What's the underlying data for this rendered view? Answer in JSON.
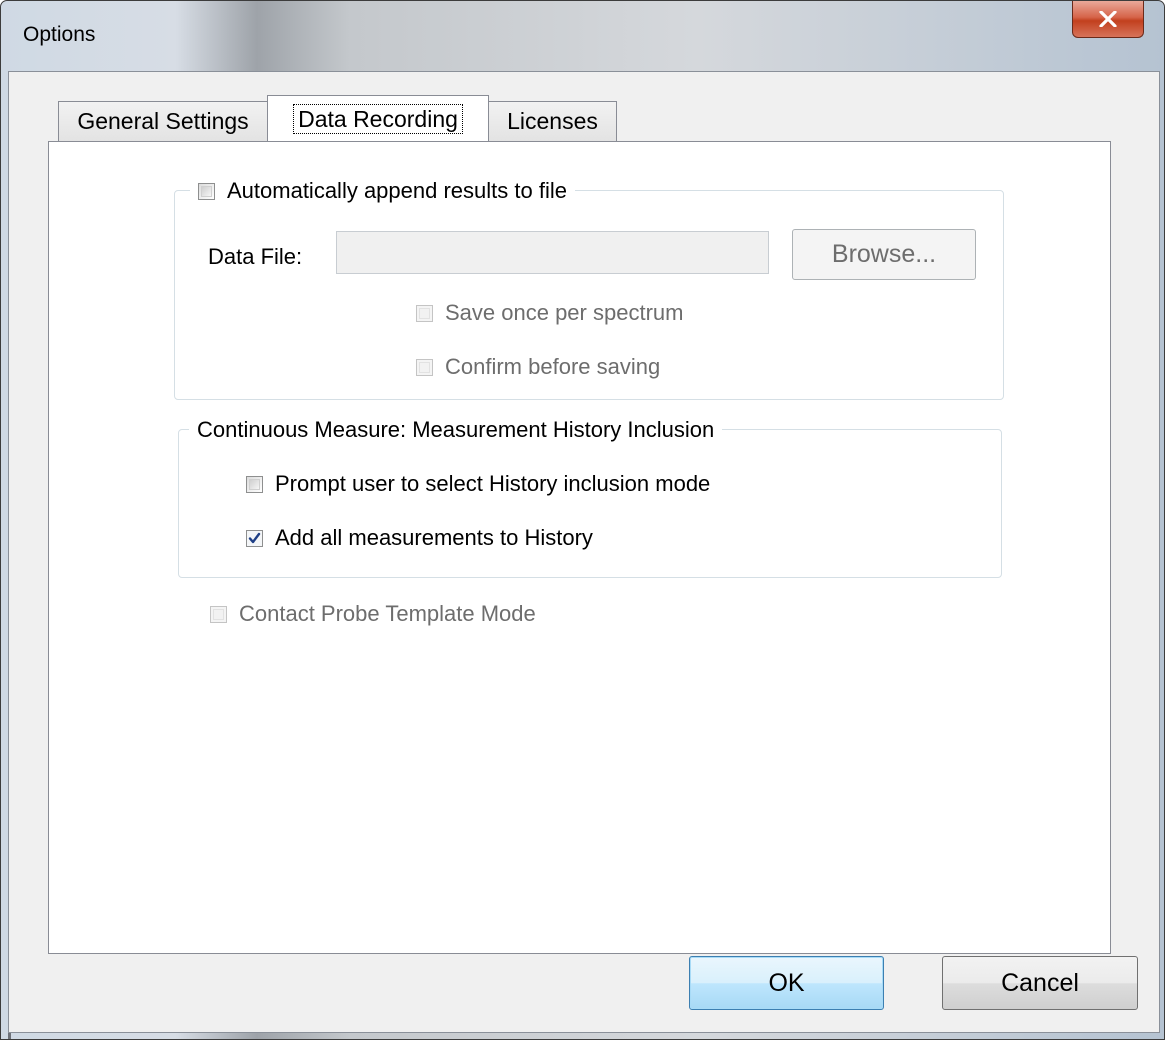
{
  "window": {
    "title": "Options"
  },
  "tabs": [
    {
      "label": "General Settings",
      "active": false
    },
    {
      "label": "Data Recording",
      "active": true
    },
    {
      "label": "Licenses",
      "active": false
    }
  ],
  "append_group": {
    "checkbox_label": "Automatically append results to file",
    "checked": false,
    "data_file_label": "Data File:",
    "data_file_value": "",
    "browse_label": "Browse...",
    "save_once_label": "Save once per spectrum",
    "confirm_label": "Confirm before saving"
  },
  "continuous_group": {
    "title": "Continuous Measure: Measurement History Inclusion",
    "prompt_label": "Prompt user to select History inclusion mode",
    "prompt_checked": false,
    "add_all_label": "Add all measurements to History",
    "add_all_checked": true
  },
  "contact_probe": {
    "label": "Contact Probe Template Mode",
    "checked": false,
    "enabled": false
  },
  "buttons": {
    "ok": "OK",
    "cancel": "Cancel"
  },
  "colors": {
    "close_red": "#c2401e",
    "default_button_border": "#3c7fb1"
  }
}
